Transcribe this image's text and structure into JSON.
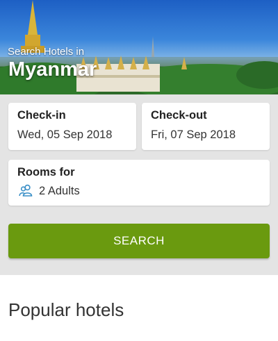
{
  "hero": {
    "subtitle": "Search Hotels in",
    "title": "Myanmar"
  },
  "form": {
    "checkin": {
      "label": "Check-in",
      "value": "Wed, 05 Sep 2018"
    },
    "checkout": {
      "label": "Check-out",
      "value": "Fri, 07 Sep 2018"
    },
    "rooms": {
      "label": "Rooms for",
      "value": "2 Adults",
      "icon": "guests-icon"
    },
    "search_label": "SEARCH"
  },
  "popular": {
    "heading": "Popular hotels"
  },
  "colors": {
    "accent": "#6a9a0f",
    "icon": "#3a8fc7",
    "background": "#e4e4e4"
  }
}
